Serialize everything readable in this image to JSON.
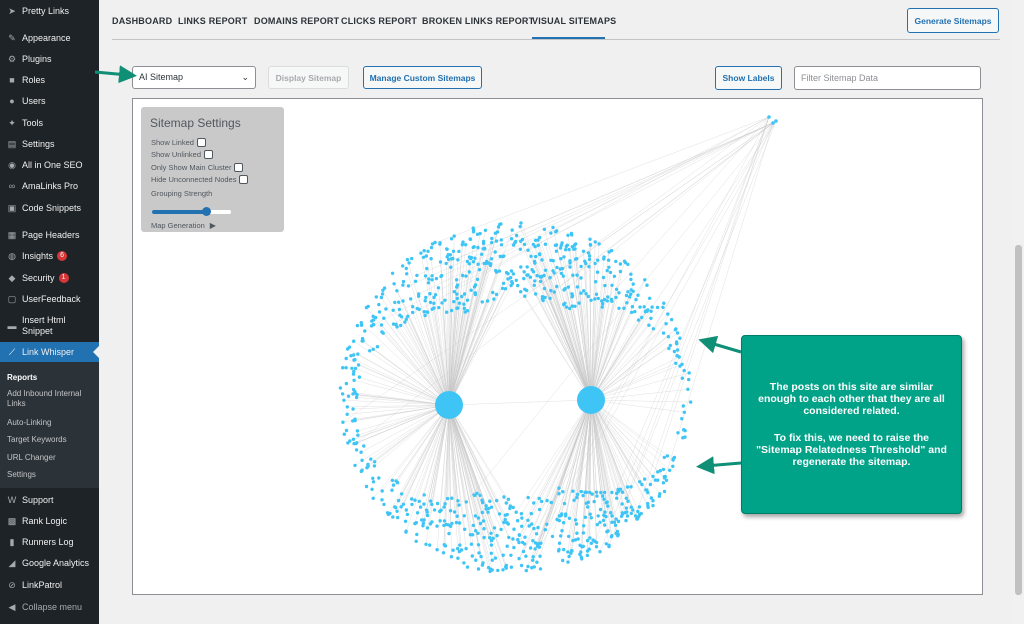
{
  "sidebar": {
    "items": [
      {
        "label": "Pretty Links",
        "icon": "pretty-links-icon",
        "glyph": "➤"
      },
      {
        "label": "Appearance",
        "icon": "paintbrush-icon",
        "glyph": "✎"
      },
      {
        "label": "Plugins",
        "icon": "plugin-icon",
        "glyph": "⚙"
      },
      {
        "label": "Roles",
        "icon": "roles-icon",
        "glyph": "■"
      },
      {
        "label": "Users",
        "icon": "users-icon",
        "glyph": "●"
      },
      {
        "label": "Tools",
        "icon": "wrench-icon",
        "glyph": "✦"
      },
      {
        "label": "Settings",
        "icon": "settings-icon",
        "glyph": "▤"
      },
      {
        "label": "All in One SEO",
        "icon": "aioseo-icon",
        "glyph": "◉"
      },
      {
        "label": "AmaLinks Pro",
        "icon": "link-icon",
        "glyph": "∞"
      },
      {
        "label": "Code Snippets",
        "icon": "code-icon",
        "glyph": "▣"
      },
      {
        "label": "Page Headers",
        "icon": "page-headers-icon",
        "glyph": "▦"
      },
      {
        "label": "Insights",
        "icon": "insights-icon",
        "glyph": "◍",
        "badge": "6"
      },
      {
        "label": "Security",
        "icon": "security-icon",
        "glyph": "◆",
        "badge": "1"
      },
      {
        "label": "UserFeedback",
        "icon": "feedback-icon",
        "glyph": "▢"
      },
      {
        "label": "Insert Html Snippet",
        "icon": "html-snippet-icon",
        "glyph": "▬"
      },
      {
        "label": "Link Whisper",
        "icon": "link-whisper-icon",
        "glyph": "⟋"
      }
    ],
    "submenu": [
      "Reports",
      "Add Inbound Internal Links",
      "Auto-Linking",
      "Target Keywords",
      "URL Changer",
      "Settings"
    ],
    "bottom_items": [
      {
        "label": "Support",
        "icon": "support-icon",
        "glyph": "W"
      },
      {
        "label": "Rank Logic",
        "icon": "rank-logic-icon",
        "glyph": "▩"
      },
      {
        "label": "Runners Log",
        "icon": "chart-icon",
        "glyph": "▮"
      },
      {
        "label": "Google Analytics",
        "icon": "analytics-icon",
        "glyph": "◢"
      },
      {
        "label": "LinkPatrol",
        "icon": "linkpatrol-icon",
        "glyph": "⊘"
      },
      {
        "label": "Collapse menu",
        "icon": "collapse-icon",
        "glyph": "◀"
      }
    ]
  },
  "tabs": [
    "DASHBOARD",
    "LINKS REPORT",
    "DOMAINS REPORT",
    "CLICKS REPORT",
    "BROKEN LINKS REPORT",
    "VISUAL SITEMAPS"
  ],
  "active_tab": "VISUAL SITEMAPS",
  "toolbar": {
    "generate_label": "Generate Sitemaps",
    "select_value": "AI Sitemap",
    "display_label": "Display Sitemap",
    "manage_label": "Manage Custom Sitemaps",
    "labels_label": "Show Labels",
    "filter_placeholder": "Filter Sitemap Data"
  },
  "settings_panel": {
    "title": "Sitemap Settings",
    "options": [
      "Show Linked",
      "Show Unlinked",
      "Only Show Main Cluster",
      "Hide Unconnected Nodes"
    ],
    "slider_label": "Grouping Strength",
    "slider_value": 0.68,
    "map_generation": "Map Generation"
  },
  "callout": {
    "paragraph1": "The posts on this site are similar enough to each other that they are all considered related.",
    "paragraph2": "To fix this, we need to raise the \"Sitemap Relatedness Threshold\" and regenerate the sitemap."
  },
  "colors": {
    "accent": "#2271b1",
    "node": "#3ec5f5",
    "annotation": "#00a388",
    "arrow": "#0f8f75"
  }
}
